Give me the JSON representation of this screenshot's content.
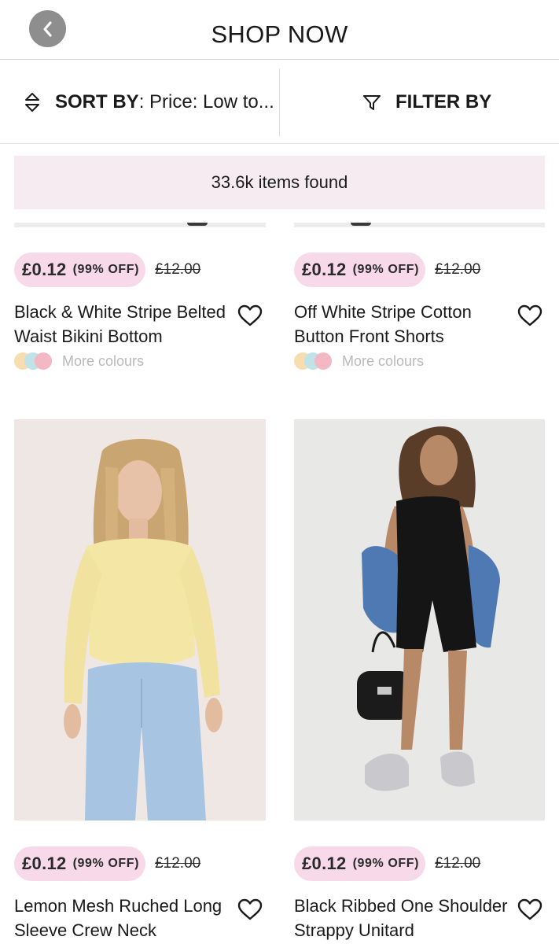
{
  "header": {
    "title": "SHOP NOW",
    "back_icon": "chevron-left-icon"
  },
  "toolbar": {
    "sort_label": "SORT BY",
    "sort_value": ": Price: Low to...",
    "sort_icon": "sort-arrows-icon",
    "filter_label": "FILTER BY",
    "filter_icon": "funnel-icon"
  },
  "results": {
    "count_text": "33.6k items found"
  },
  "colors": {
    "accent_pink": "#f7d9e9",
    "banner_pink": "#f7ebf2",
    "swatch_yellow": "#f6deb0",
    "swatch_blue": "#bfe3e8",
    "swatch_pink": "#f4b7c4"
  },
  "products": [
    {
      "price": "£0.12",
      "discount": "(99% OFF)",
      "original_price": "£12.00",
      "name": "Black & White Stripe Belted Waist Bikini Bottom",
      "more_colours": "More colours"
    },
    {
      "price": "£0.12",
      "discount": "(99% OFF)",
      "original_price": "£12.00",
      "name": "Off White Stripe Cotton Button Front Shorts",
      "more_colours": "More colours"
    },
    {
      "price": "£0.12",
      "discount": "(99% OFF)",
      "original_price": "£12.00",
      "name": "Lemon Mesh Ruched Long Sleeve Crew Neck"
    },
    {
      "price": "£0.12",
      "discount": "(99% OFF)",
      "original_price": "£12.00",
      "name": "Black Ribbed One Shoulder Strappy Unitard"
    }
  ]
}
